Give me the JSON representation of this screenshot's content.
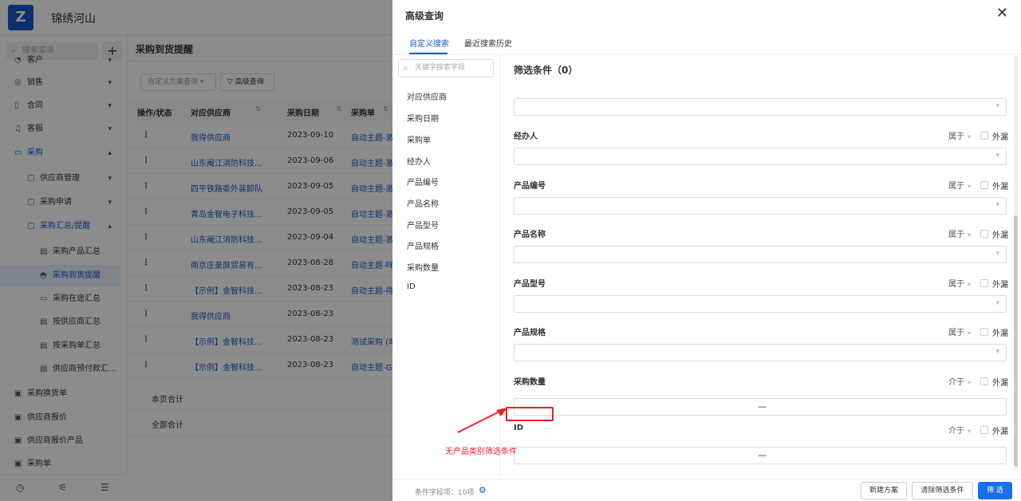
{
  "app": {
    "title": "锦绣河山",
    "logo_text": "Z"
  },
  "sidebar": {
    "search_placeholder": "搜索菜单",
    "add_label": "+",
    "items": [
      {
        "icon": "user-icon",
        "label": "客户",
        "chev": "▾"
      },
      {
        "icon": "sales-icon",
        "label": "销售",
        "chev": "▾"
      },
      {
        "icon": "contract-icon",
        "label": "合同",
        "chev": "▾"
      },
      {
        "icon": "service-icon",
        "label": "客服",
        "chev": "▾"
      },
      {
        "icon": "cart-icon",
        "label": "采购",
        "chev": "▴"
      },
      {
        "icon": "supplier-icon",
        "label": "供应商管理",
        "chev": "▾"
      },
      {
        "icon": "request-icon",
        "label": "采购申请",
        "chev": "▾"
      },
      {
        "icon": "summary-icon",
        "label": "采购汇总/提醒",
        "chev": "▴"
      },
      {
        "icon": "doc-icon",
        "label": "采购产品汇总"
      },
      {
        "icon": "bell-icon",
        "label": "采购到货提醒"
      },
      {
        "icon": "truck-icon",
        "label": "采购在途汇总"
      },
      {
        "icon": "doc-icon",
        "label": "按供应商汇总"
      },
      {
        "icon": "doc-icon",
        "label": "按采购单汇总"
      },
      {
        "icon": "doc-icon",
        "label": "供应商预付款汇..."
      },
      {
        "icon": "exchange-icon",
        "label": "采购换货单"
      },
      {
        "icon": "quote-icon",
        "label": "供应商报价"
      },
      {
        "icon": "quote-icon",
        "label": "供应商报价产品"
      },
      {
        "icon": "order-icon",
        "label": "采购单"
      }
    ],
    "bottom_icons": [
      "history-icon",
      "filter-icon",
      "menu-icon"
    ]
  },
  "main": {
    "page_title": "采购到货提醒",
    "scheme_placeholder": "自定义方案查询",
    "adv_button": "高级查询",
    "columns": [
      "操作/状态",
      "对应供应商",
      "采购日期",
      "采购单"
    ],
    "rows": [
      {
        "supplier": "我得供应商",
        "date": "2023-09-10",
        "order": "自动主题-激光"
      },
      {
        "supplier": "山东阉江消防科技...",
        "date": "2023-09-06",
        "order": "自动主题-激光"
      },
      {
        "supplier": "四平铁路委外装卸队",
        "date": "2023-09-05",
        "order": "自动主题-激光"
      },
      {
        "supplier": "青岛金智电子科技...",
        "date": "2023-09-05",
        "order": "自动主题-激光"
      },
      {
        "supplier": "山东阉江消防科技...",
        "date": "2023-09-04",
        "order": "自动主题-激光"
      },
      {
        "supplier": "南京庄录屏贸易有...",
        "date": "2023-08-28",
        "order": "自动主题-咩哼"
      },
      {
        "supplier": "【示例】金智科技...",
        "date": "2023-08-23",
        "order": "自动主题-得之"
      },
      {
        "supplier": "我得供应商",
        "date": "2023-08-23",
        "order": ""
      },
      {
        "supplier": "【示例】金智科技...",
        "date": "2023-08-23",
        "order": "测试采购 (单"
      },
      {
        "supplier": "【示例】金智科技...",
        "date": "2023-08-23",
        "order": "自动主题-GVC"
      }
    ],
    "page_total": "本页合计",
    "all_total": "全部合计"
  },
  "drawer": {
    "title": "高级查询",
    "close": "✕",
    "tabs": [
      "自定义搜索",
      "最近搜索历史"
    ],
    "keyword_placeholder": "关键字搜索字段",
    "fields": [
      "对应供应商",
      "采购日期",
      "采购单",
      "经办人",
      "产品编号",
      "产品名称",
      "产品型号",
      "产品规格",
      "采购数量",
      "ID"
    ],
    "filter_header": "筛选条件（0）",
    "filters": [
      {
        "label": "经办人",
        "op": "属于",
        "exclude": "外漏",
        "kind": "select"
      },
      {
        "label": "产品编号",
        "op": "属于",
        "exclude": "外漏",
        "kind": "select"
      },
      {
        "label": "产品名称",
        "op": "属于",
        "exclude": "外漏",
        "kind": "select"
      },
      {
        "label": "产品型号",
        "op": "属于",
        "exclude": "外漏",
        "kind": "select"
      },
      {
        "label": "产品规格",
        "op": "属于",
        "exclude": "外漏",
        "kind": "select"
      },
      {
        "label": "采购数量",
        "op": "介于",
        "exclude": "外漏",
        "kind": "range"
      },
      {
        "label": "ID",
        "op": "介于",
        "exclude": "外漏",
        "kind": "range"
      }
    ],
    "range_sep": "—",
    "footer_count": "条件字段项：10项",
    "buttons": {
      "new_scheme": "新建方案",
      "clear": "清除筛选条件",
      "filter": "筛 选"
    }
  },
  "annotation": {
    "text": "无产品类别筛选条件",
    "color": "#e8202a"
  },
  "colors": {
    "accent": "#1a57c9",
    "primary_button": "#1a6ef0",
    "annotation": "#e8202a"
  }
}
